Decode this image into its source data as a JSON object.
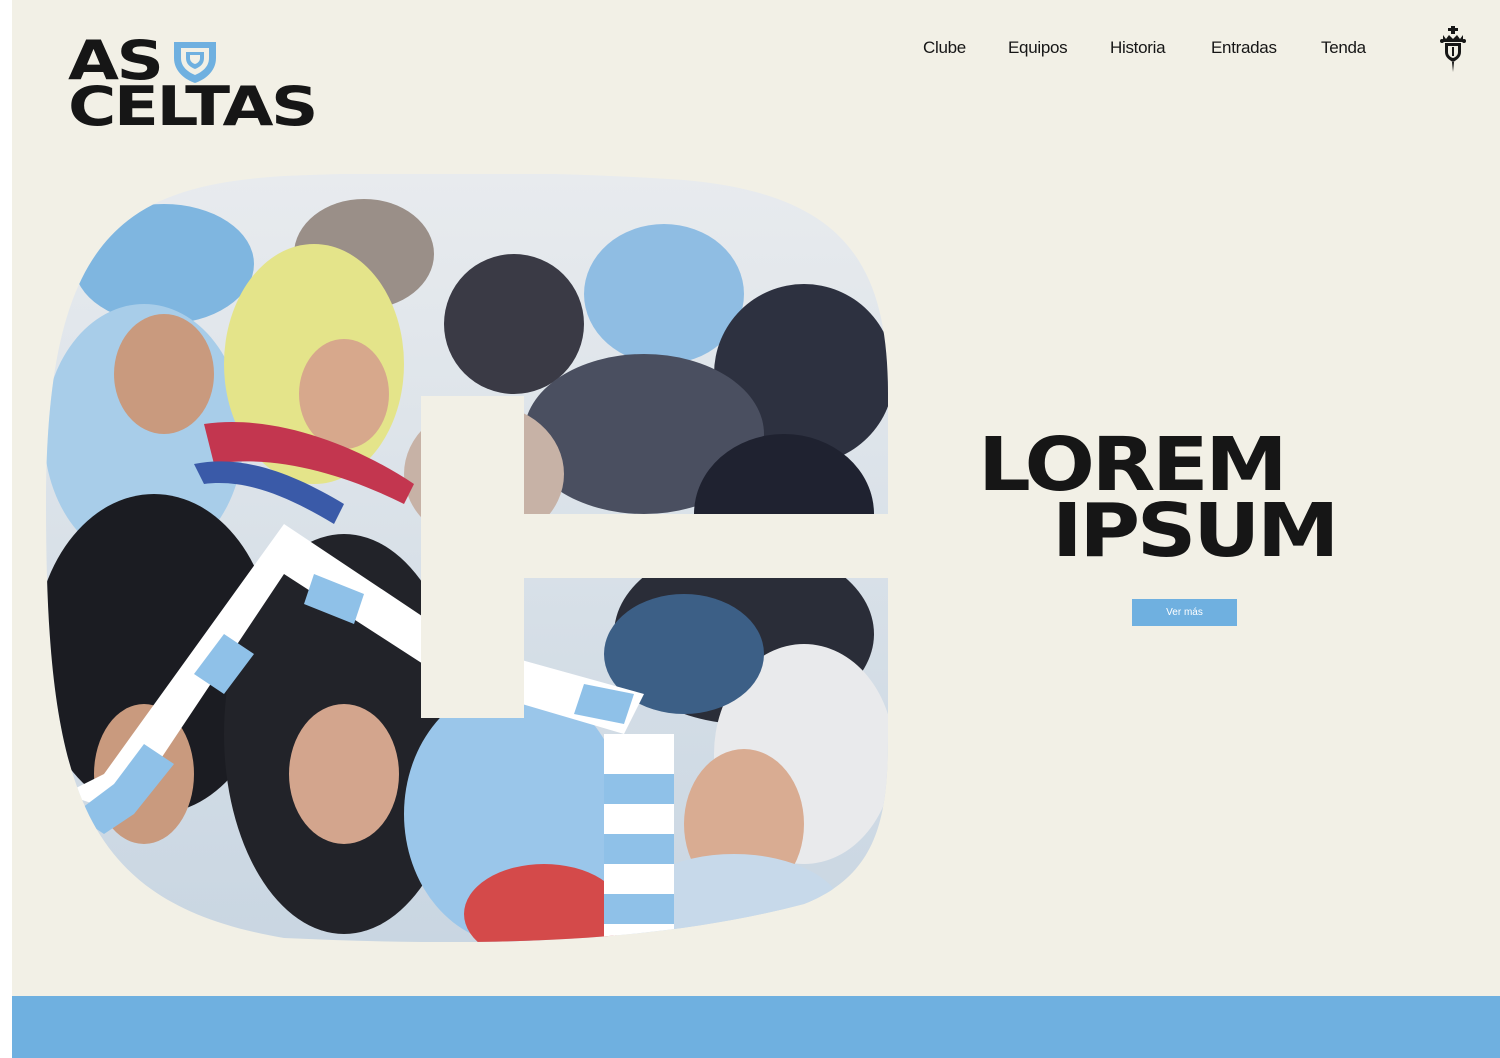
{
  "brand": {
    "logo_line1": "AS",
    "logo_line2": "CELTAS",
    "accent_color": "#6fb0e0",
    "ink_color": "#161616",
    "background_color": "#f2f0e6"
  },
  "nav": {
    "items": [
      {
        "label": "Clube"
      },
      {
        "label": "Equipos"
      },
      {
        "label": "Historia"
      },
      {
        "label": "Entradas"
      },
      {
        "label": "Tenda"
      }
    ],
    "crest_icon": "club-crest-icon"
  },
  "hero": {
    "image_subject": "celta-fans-cheering-with-scarves",
    "headline_line1": "LOREM",
    "headline_line2": "IPSUM",
    "cta_label": "Ver más"
  }
}
